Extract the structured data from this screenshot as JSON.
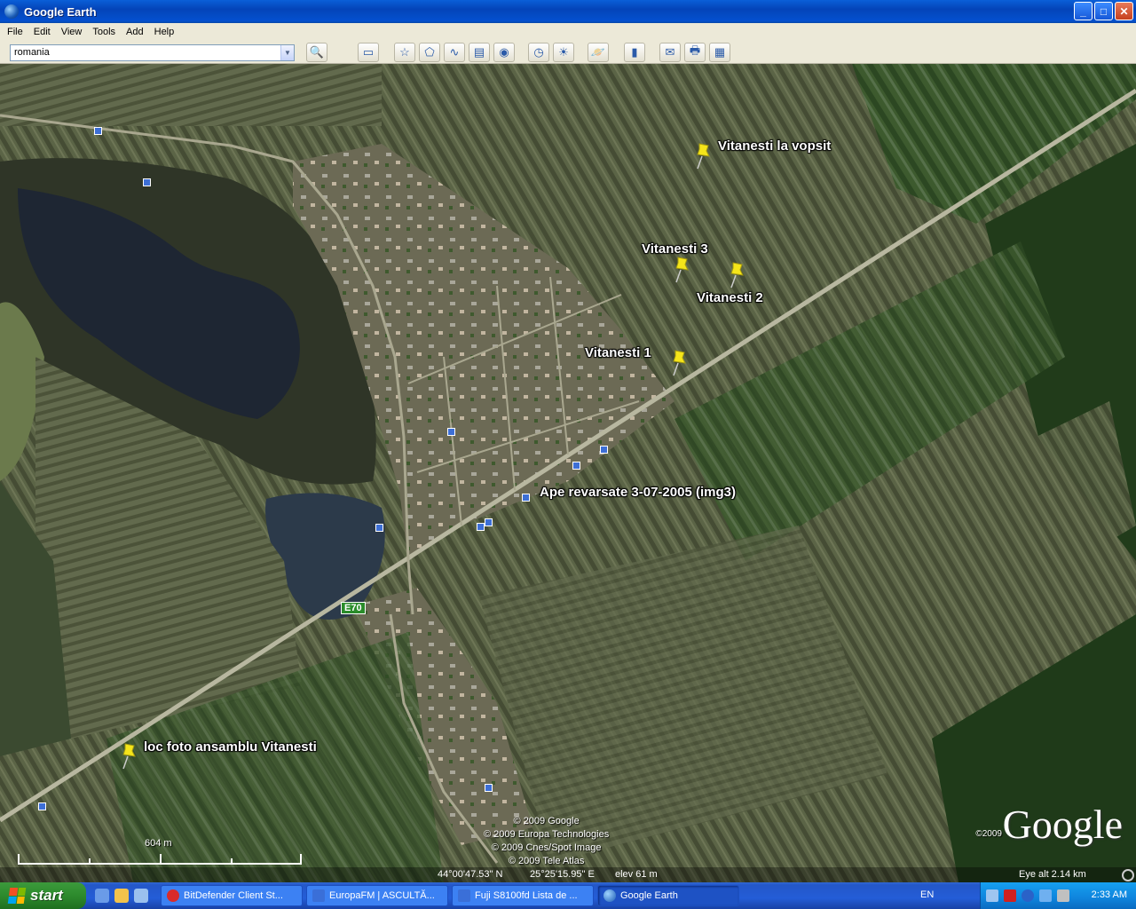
{
  "window": {
    "title": "Google Earth"
  },
  "menu": [
    "File",
    "Edit",
    "View",
    "Tools",
    "Add",
    "Help"
  ],
  "search": {
    "value": "romania"
  },
  "toolbar_icons": [
    "search-icon",
    "sidebar-icon",
    "placemark-icon",
    "polygon-icon",
    "path-icon",
    "overlay-icon",
    "record-tour-icon",
    "historical-imagery-icon",
    "sunlight-icon",
    "planet-icon",
    "ruler-icon",
    "email-icon",
    "print-icon",
    "view-in-maps-icon"
  ],
  "placemarks": [
    {
      "label": "Vitanesti la vopsit"
    },
    {
      "label": "Vitanesti 3"
    },
    {
      "label": "Vitanesti 2"
    },
    {
      "label": "Vitanesti 1"
    },
    {
      "label": "Ape revarsate 3-07-2005 (img3)"
    },
    {
      "label": "loc foto ansamblu Vitanesti"
    }
  ],
  "road_shield": "E70",
  "copyright_lines": [
    "© 2009 Google",
    "© 2009 Europa Technologies",
    "© 2009 Cnes/Spot Image",
    "© 2009 Tele Atlas"
  ],
  "google_logo": "Google",
  "google_copyright": "©2009",
  "scale_label": "604 m",
  "status": {
    "lat": "44°00'47.53\" N",
    "lon": "25°25'15.95\" E",
    "elev": "elev   61 m",
    "eye_alt": "Eye alt    2.14 km"
  },
  "taskbar": {
    "start_label": "start",
    "tasks": [
      {
        "label": "BitDefender Client St...",
        "active": false
      },
      {
        "label": "EuropaFM | ASCULTĂ...",
        "active": false
      },
      {
        "label": "Fuji S8100fd Lista de ...",
        "active": false
      },
      {
        "label": "Google Earth",
        "active": true
      }
    ],
    "language": "EN",
    "clock": "2:33 AM"
  },
  "colors": {
    "title_bar": "#0a5fd8",
    "taskbar": "#245dd7",
    "start": "#2d8a2d",
    "pin": "#f5e51a",
    "photo_marker": "#3d6fd6"
  }
}
